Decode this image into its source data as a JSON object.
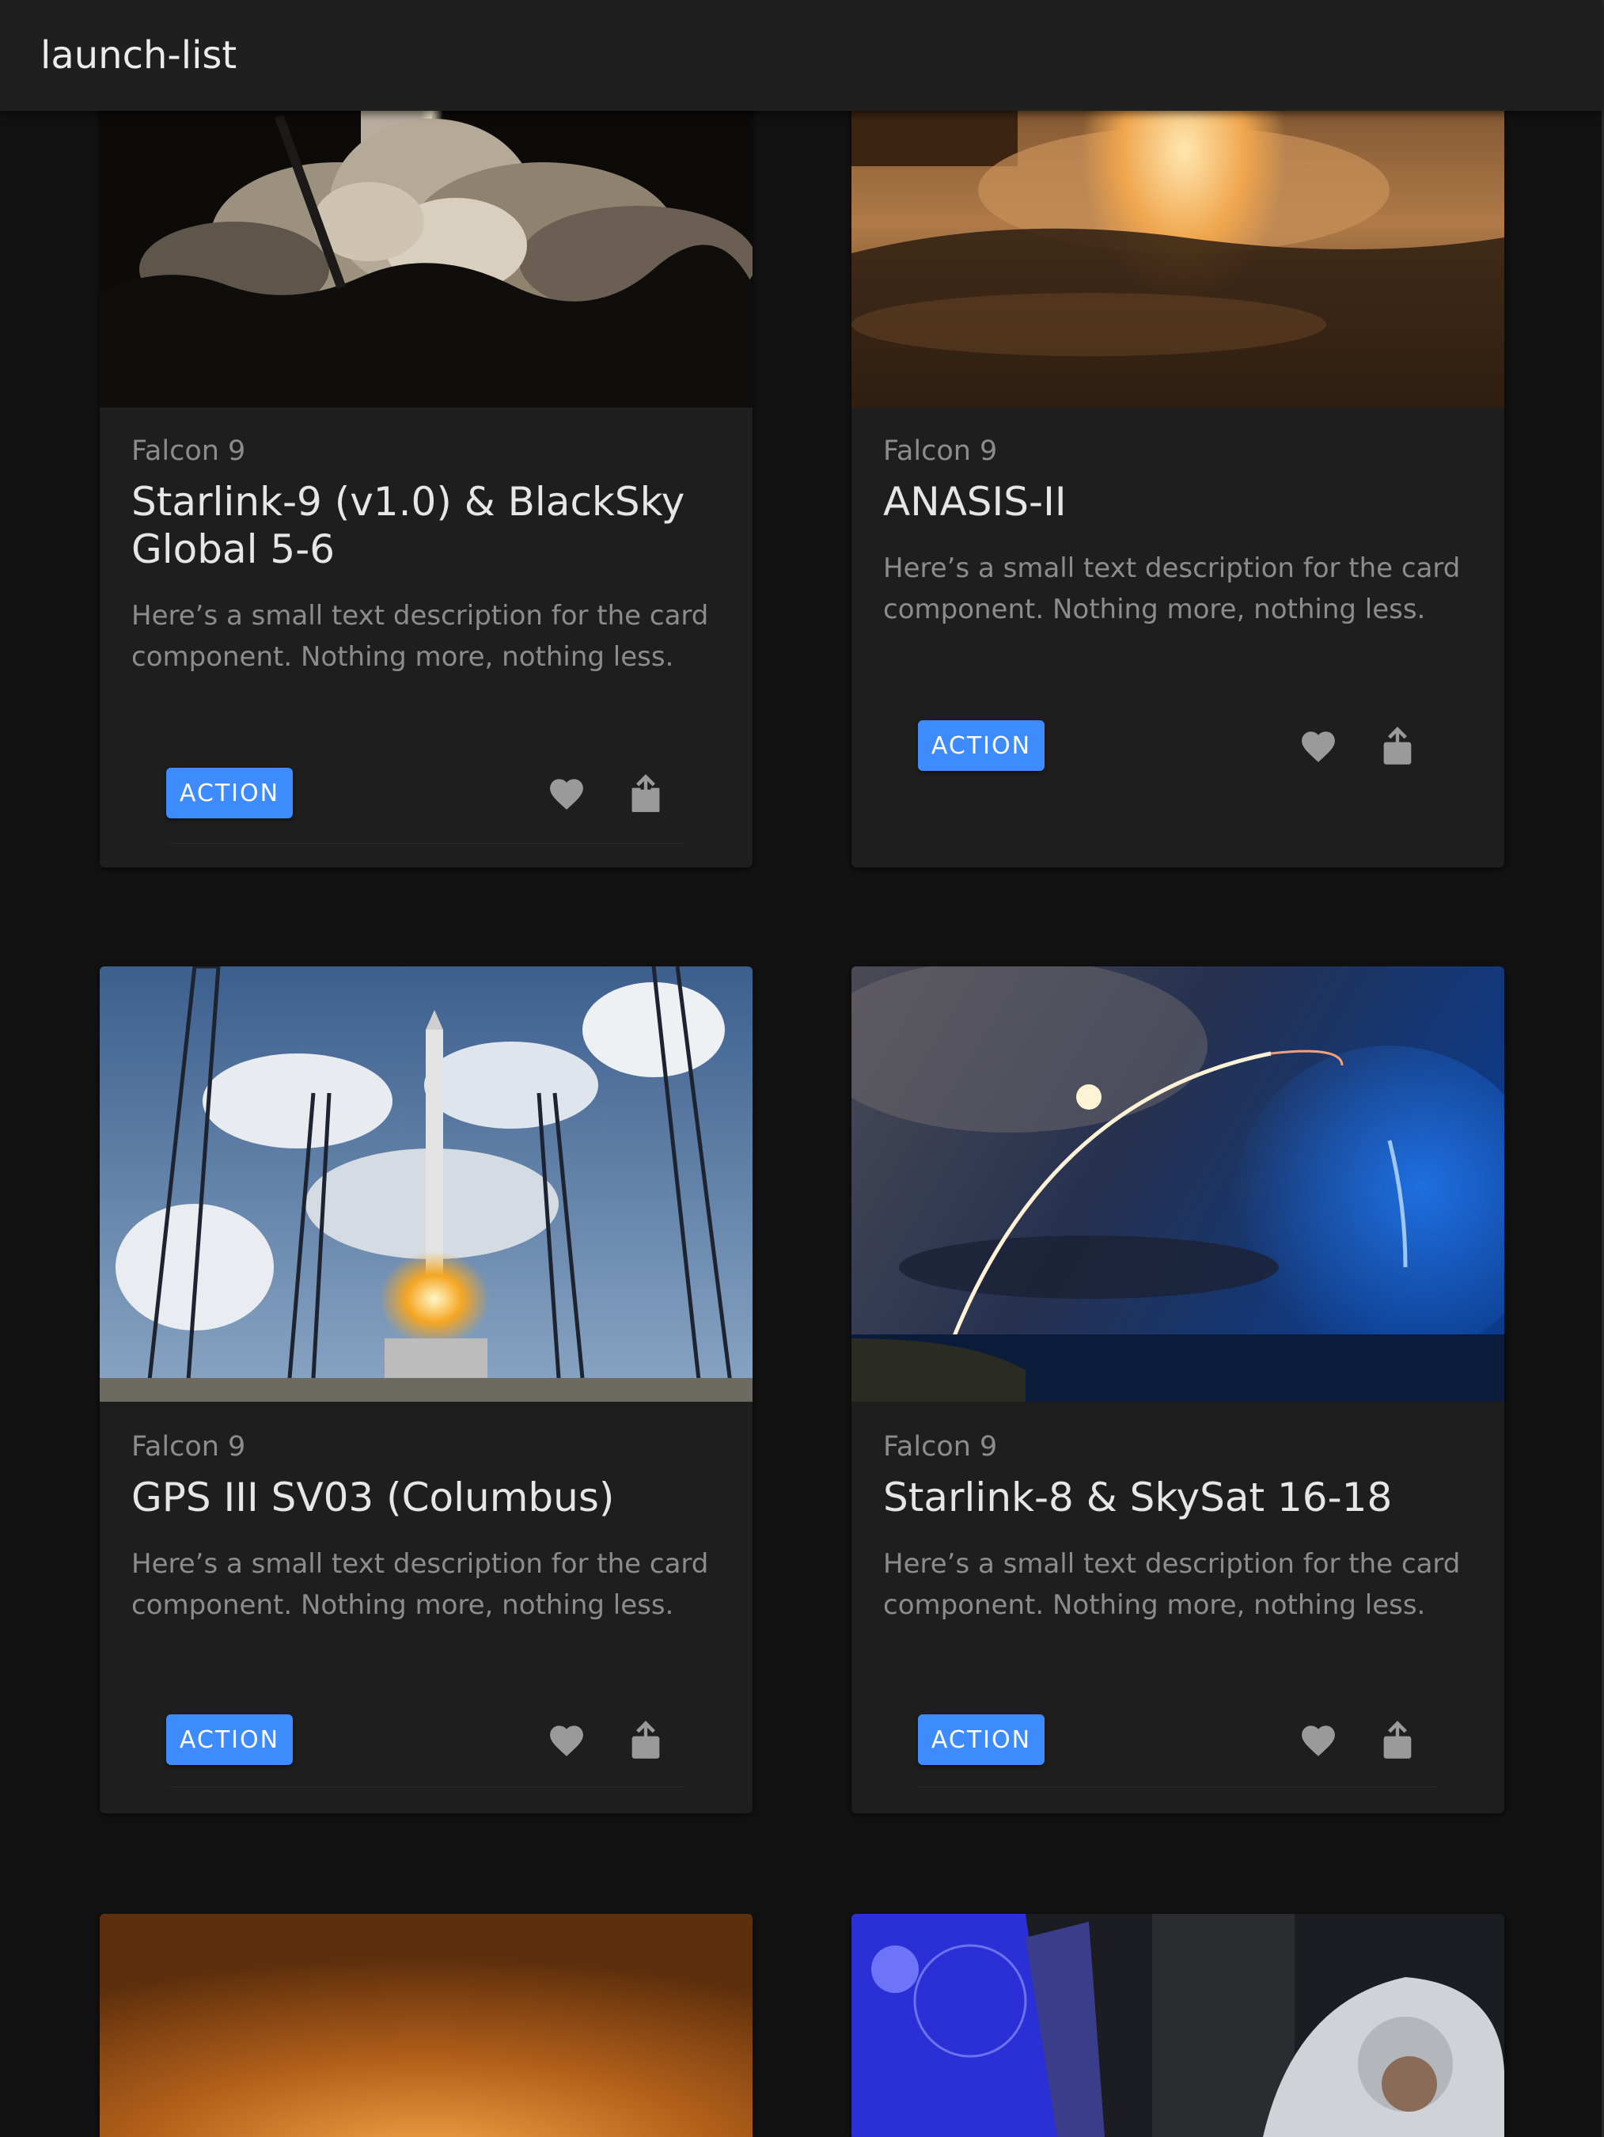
{
  "app": {
    "title": "launch-list"
  },
  "colors": {
    "background": "#121212",
    "appbar": "#1f1f1f",
    "card": "#1e1e1e",
    "accent": "#3d8bfd",
    "icon": "#9a9a9a"
  },
  "cards": [
    {
      "rocket": "Falcon 9",
      "mission": "Starlink-9 (v1.0) & BlackSky Global 5-6",
      "description": "Here’s a small text description for the card component. Nothing more, nothing less.",
      "action_label": "ACTION",
      "favorite_icon": "heart-icon",
      "share_icon": "share-icon",
      "image": "rocket liftoff clouds at night"
    },
    {
      "rocket": "Falcon 9",
      "mission": "ANASIS-II",
      "description": "Here’s a small text description for the card component. Nothing more, nothing less.",
      "action_label": "ACTION",
      "favorite_icon": "heart-icon",
      "share_icon": "share-icon",
      "image": "engine fire and exhaust"
    },
    {
      "rocket": "Falcon 9",
      "mission": "GPS III SV03 (Columbus)",
      "description": "Here’s a small text description for the card component. Nothing more, nothing less.",
      "action_label": "ACTION",
      "favorite_icon": "heart-icon",
      "share_icon": "share-icon",
      "image": "rocket launching between towers"
    },
    {
      "rocket": "Falcon 9",
      "mission": "Starlink-8 & SkySat 16-18",
      "description": "Here’s a small text description for the card component. Nothing more, nothing less.",
      "action_label": "ACTION",
      "favorite_icon": "heart-icon",
      "share_icon": "share-icon",
      "image": "launch trail arc over ocean at dusk"
    },
    {
      "image": "orange glow"
    },
    {
      "image": "astronaut in capsule with blue screens"
    }
  ]
}
